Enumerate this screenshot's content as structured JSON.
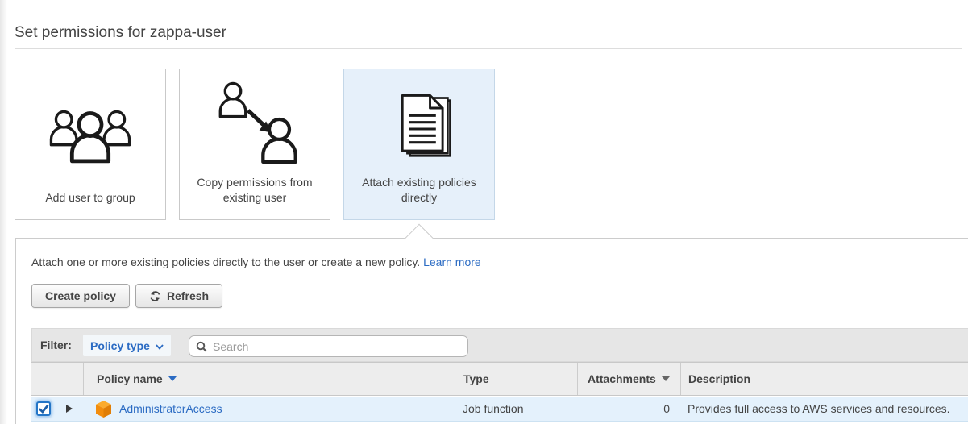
{
  "page": {
    "title": "Set permissions for zappa-user"
  },
  "cards": [
    {
      "label": "Add user to group",
      "icon": "users-group-icon",
      "selected": false
    },
    {
      "label": "Copy permissions from existing user",
      "icon": "copy-user-icon",
      "selected": false
    },
    {
      "label": "Attach existing policies directly",
      "icon": "policies-stack-icon",
      "selected": true
    }
  ],
  "panel": {
    "description": "Attach one or more existing policies directly to the user or create a new policy.",
    "learn_more": "Learn more",
    "buttons": {
      "create_policy": "Create policy",
      "refresh": "Refresh"
    },
    "filter": {
      "label": "Filter:",
      "dropdown": "Policy type",
      "search_placeholder": "Search"
    }
  },
  "table": {
    "columns": [
      {
        "label": "Policy name",
        "sorted": true
      },
      {
        "label": "Type",
        "sorted": false
      },
      {
        "label": "Attachments",
        "sorted": true
      },
      {
        "label": "Description",
        "sorted": false
      }
    ],
    "rows": [
      {
        "checked": true,
        "policy_name": "AdministratorAccess",
        "type": "Job function",
        "attachments": "0",
        "description": "Provides full access to AWS services and resources."
      }
    ]
  },
  "colors": {
    "link_blue": "#2b6bc3",
    "selected_card_bg": "#e6f0fa",
    "selected_card_border": "#c4d7e8",
    "row_highlight": "#e4f1fc",
    "checkbox_blue": "#2576c7",
    "cube_orange": "#f49317"
  }
}
